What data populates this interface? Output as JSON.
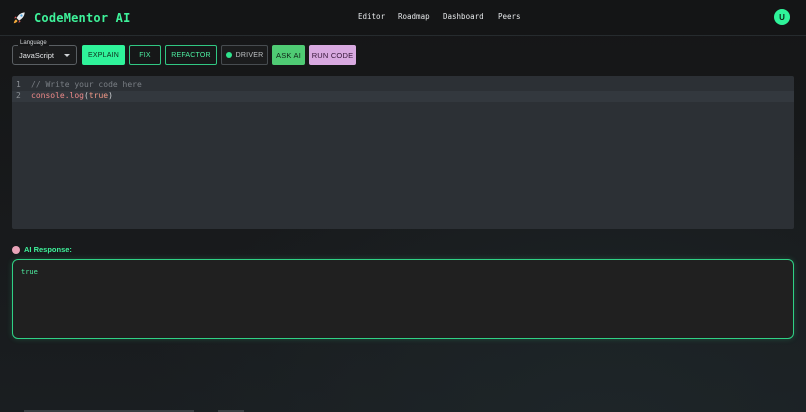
{
  "app": {
    "title": "CodeMentor AI",
    "brand_color": "#3ef29a",
    "logo_icon": "rocket-icon"
  },
  "nav": {
    "items": [
      {
        "label": "Editor"
      },
      {
        "label": "Roadmap"
      },
      {
        "label": "Dashboard"
      },
      {
        "label": "Peers"
      }
    ]
  },
  "user": {
    "avatar_initial": "U"
  },
  "toolbar": {
    "language_label": "Language",
    "language_value": "JavaScript",
    "explain_label": "EXPLAIN",
    "fix_label": "FIX",
    "refactor_label": "REFACTOR",
    "driver_label": "DRIVER",
    "ask_ai_label": "ASK AI",
    "run_code_label": "RUN CODE"
  },
  "editor": {
    "lines": [
      {
        "number": "1",
        "text": "// Write your code here"
      },
      {
        "number": "2",
        "ident": "console.log",
        "open": "(",
        "arg": "true",
        "close": ")"
      }
    ]
  },
  "ai_response": {
    "label": "AI Response:",
    "text": "true"
  }
}
